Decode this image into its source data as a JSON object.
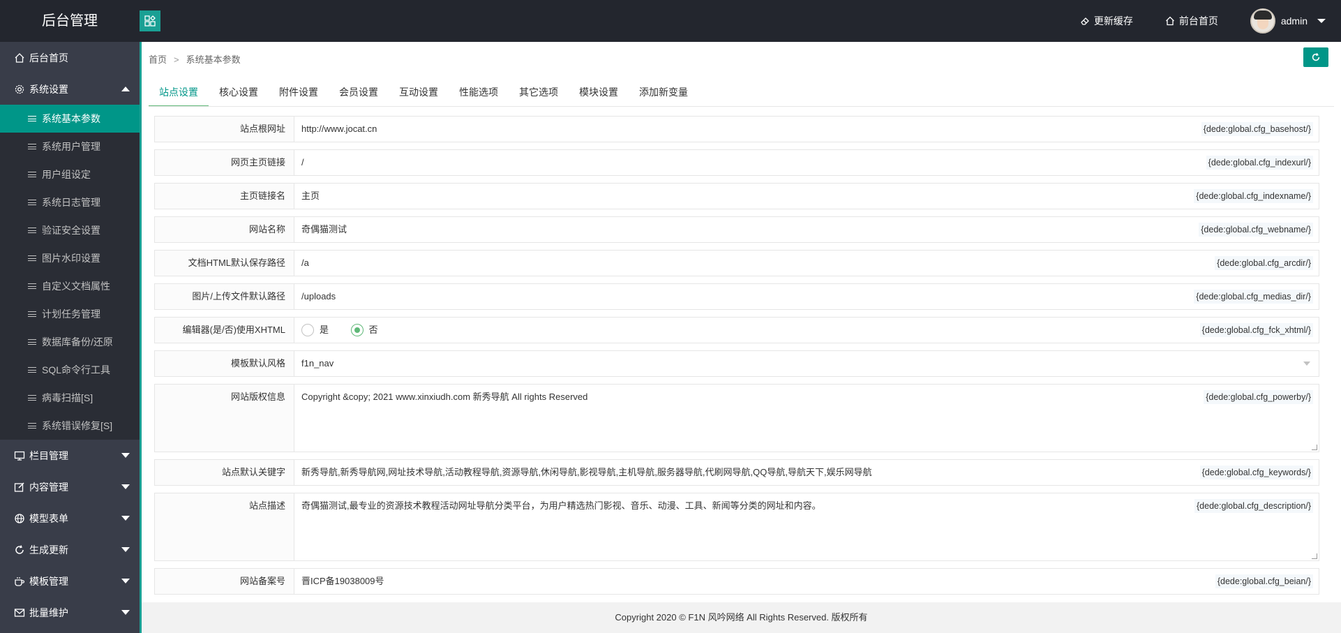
{
  "header": {
    "logo": "后台管理",
    "links": [
      {
        "label": "更新缓存",
        "icon": "eraser-icon"
      },
      {
        "label": "前台首页",
        "icon": "home-icon"
      }
    ],
    "user": "admin"
  },
  "sidebar": {
    "home": "后台首页",
    "groups": [
      {
        "label": "系统设置",
        "icon": "gear-icon",
        "expanded": true
      },
      {
        "label": "栏目管理",
        "icon": "monitor-icon"
      },
      {
        "label": "内容管理",
        "icon": "edit-icon"
      },
      {
        "label": "模型表单",
        "icon": "globe-icon"
      },
      {
        "label": "生成更新",
        "icon": "refresh-icon"
      },
      {
        "label": "模板管理",
        "icon": "cup-icon"
      },
      {
        "label": "批量维护",
        "icon": "mail-icon"
      }
    ],
    "system_items": [
      "系统基本参数",
      "系统用户管理",
      "用户组设定",
      "系统日志管理",
      "验证安全设置",
      "图片水印设置",
      "自定义文档属性",
      "计划任务管理",
      "数据库备份/还原",
      "SQL命令行工具",
      "病毒扫描[S]",
      "系统错误修复[S]"
    ],
    "active_item": "系统基本参数"
  },
  "breadcrumb": {
    "home": "首页",
    "sep": ">",
    "current": "系统基本参数"
  },
  "tabs": [
    "站点设置",
    "核心设置",
    "附件设置",
    "会员设置",
    "互动设置",
    "性能选项",
    "其它选项",
    "模块设置",
    "添加新变量"
  ],
  "form": {
    "basehost": {
      "label": "站点根网址",
      "value": "http://www.jocat.cn",
      "tag": "{dede:global.cfg_basehost/}"
    },
    "indexurl": {
      "label": "网页主页链接",
      "value": "/",
      "tag": "{dede:global.cfg_indexurl/}"
    },
    "indexname": {
      "label": "主页链接名",
      "value": "主页",
      "tag": "{dede:global.cfg_indexname/}"
    },
    "webname": {
      "label": "网站名称",
      "value": "奇偶猫测试",
      "tag": "{dede:global.cfg_webname/}"
    },
    "arcdir": {
      "label": "文档HTML默认保存路径",
      "value": "/a",
      "tag": "{dede:global.cfg_arcdir/}"
    },
    "medias_dir": {
      "label": "图片/上传文件默认路径",
      "value": "/uploads",
      "tag": "{dede:global.cfg_medias_dir/}"
    },
    "fck_xhtml": {
      "label": "编辑器(是/否)使用XHTML",
      "yes": "是",
      "no": "否",
      "selected": "否",
      "tag": "{dede:global.cfg_fck_xhtml/}"
    },
    "df_style": {
      "label": "模板默认风格",
      "value": "f1n_nav"
    },
    "powerby": {
      "label": "网站版权信息",
      "value": "Copyright &copy; 2021 www.xinxiudh.com  新秀导航 All rights Reserved",
      "tag": "{dede:global.cfg_powerby/}"
    },
    "keywords": {
      "label": "站点默认关键字",
      "value": "新秀导航,新秀导航网,网址技术导航,活动教程导航,资源导航,休闲导航,影视导航,主机导航,服务器导航,代刷网导航,QQ导航,导航天下,娱乐网导航",
      "tag": "{dede:global.cfg_keywords/}"
    },
    "description": {
      "label": "站点描述",
      "value": "奇偶猫测试,最专业的资源技术教程活动网址导航分类平台，为用户精选热门影视、音乐、动漫、工具、新闻等分类的网址和内容。",
      "tag": "{dede:global.cfg_description/}"
    },
    "beian": {
      "label": "网站备案号",
      "value": "晋ICP备19038009号",
      "tag": "{dede:global.cfg_beian/}"
    }
  },
  "footer": "Copyright 2020 © F1N 风吟网络 All Rights Reserved. 版权所有",
  "colors": {
    "accent": "#009688",
    "sidebar": "#393d49",
    "header": "#23262e"
  }
}
